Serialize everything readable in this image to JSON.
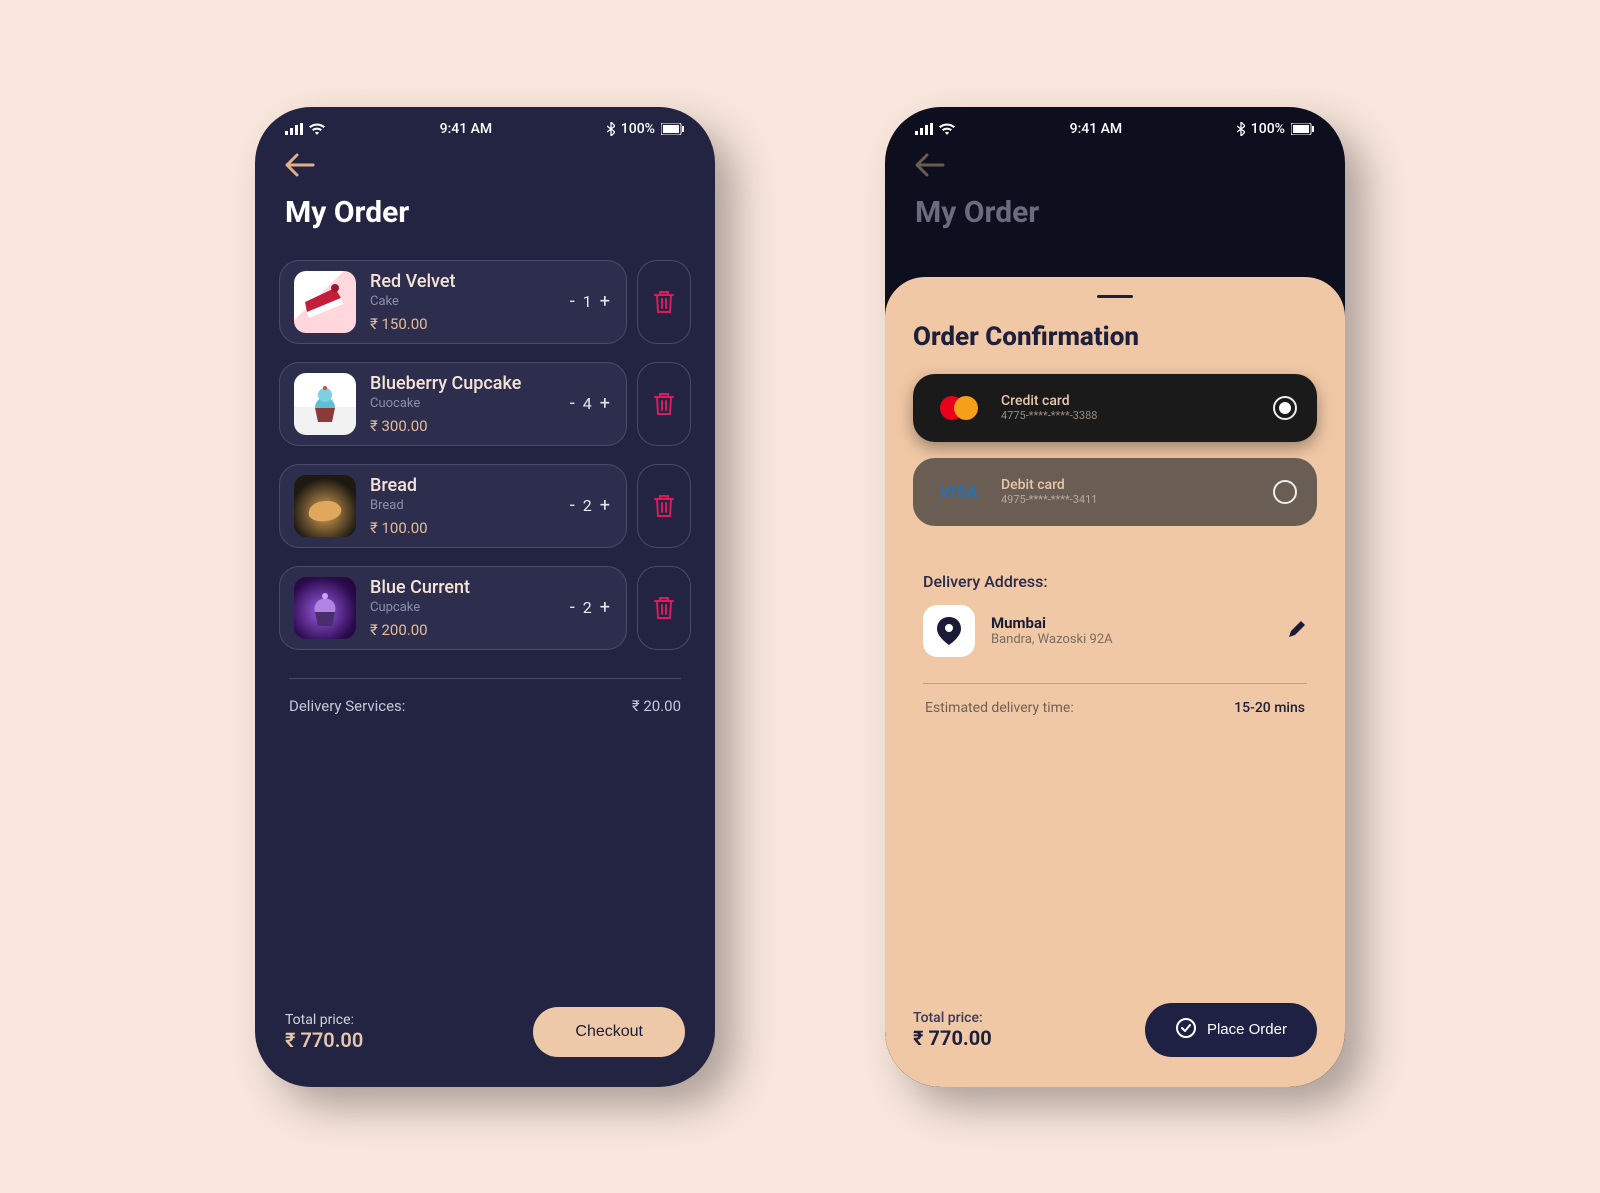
{
  "status": {
    "time": "9:41 AM",
    "battery": "100%"
  },
  "back_aria": "Back",
  "cart": {
    "title": "My Order",
    "items": [
      {
        "name": "Red Velvet",
        "sub": "Cake",
        "price": "₹ 150.00",
        "qty": "1"
      },
      {
        "name": "Blueberry Cupcake",
        "sub": "Cuocake",
        "price": "₹ 300.00",
        "qty": "4"
      },
      {
        "name": "Bread",
        "sub": "Bread",
        "price": "₹ 100.00",
        "qty": "2"
      },
      {
        "name": "Blue Current",
        "sub": "Cupcake",
        "price": "₹ 200.00",
        "qty": "2"
      }
    ],
    "delivery_label": "Delivery Services:",
    "delivery_fee": "₹ 20.00",
    "total_label": "Total price:",
    "total_price": "₹ 770.00",
    "checkout": "Checkout"
  },
  "confirm": {
    "overlay_title": "My Order",
    "title": "Order Confirmation",
    "cards": [
      {
        "type": "Credit card",
        "num": "4775-****-****-3388",
        "brand": "mastercard",
        "selected": true
      },
      {
        "type": "Debit card",
        "num": "4975-****-****-3411",
        "brand": "visa",
        "selected": false
      }
    ],
    "address_label": "Delivery Address:",
    "city": "Mumbai",
    "street": "Bandra, Wazoski 92A",
    "eta_label": "Estimated delivery time:",
    "eta_value": "15-20 mins",
    "total_label": "Total price:",
    "total_price": "₹ 770.00",
    "place": "Place Order",
    "visa_text": "VISA"
  }
}
